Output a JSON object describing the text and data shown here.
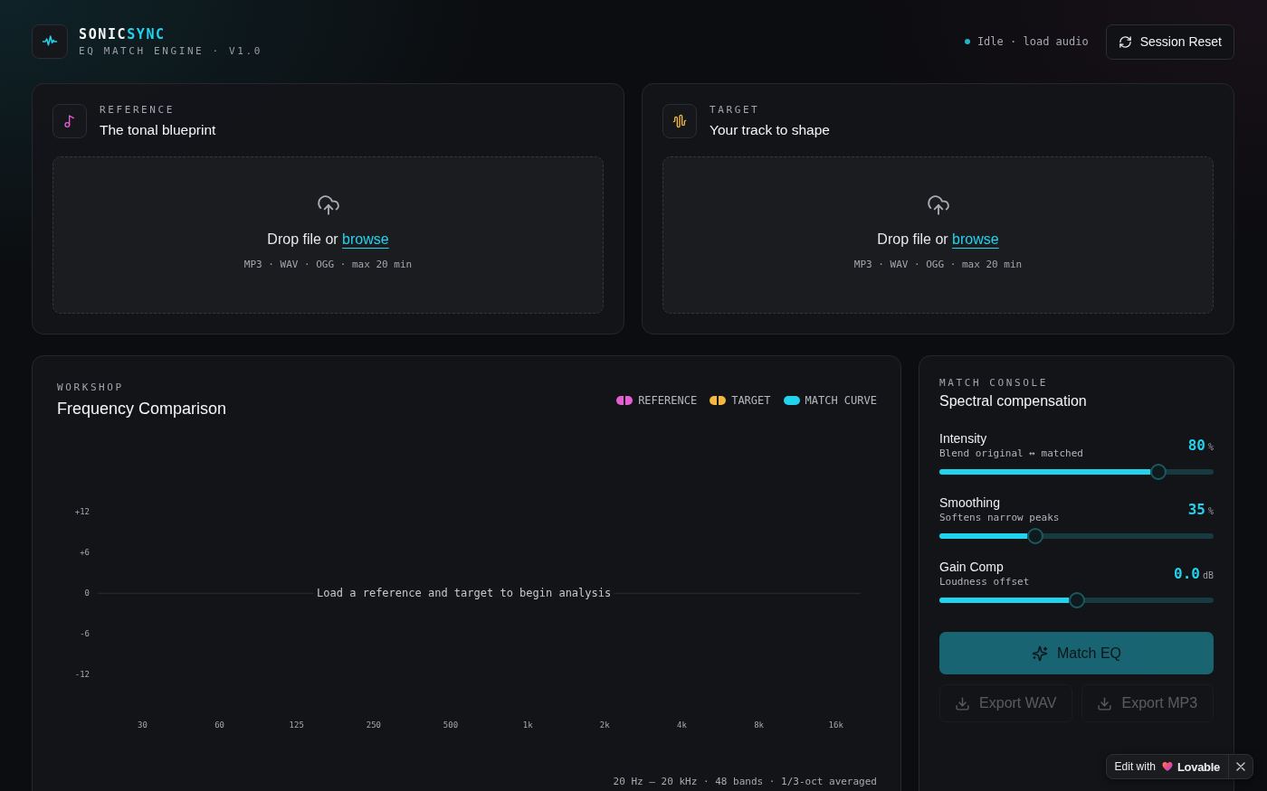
{
  "header": {
    "brand": {
      "name_main": "SONIC",
      "name_accent": "SYNC",
      "subtitle": "EQ MATCH ENGINE · V1.0"
    },
    "status": {
      "text": "Idle · load audio"
    },
    "reset_button": {
      "label": "Session Reset"
    }
  },
  "sources": [
    {
      "kind": "reference",
      "label": "REFERENCE",
      "title": "The tonal blueprint",
      "drop_text": "Drop file or",
      "browse_link": "browse",
      "formats": "MP3 · WAV · OGG · max 20 min"
    },
    {
      "kind": "target",
      "label": "TARGET",
      "title": "Your track to shape",
      "drop_text": "Drop file or",
      "browse_link": "browse",
      "formats": "MP3 · WAV · OGG · max 20 min"
    }
  ],
  "workshop": {
    "eyebrow": "WORKSHOP",
    "title": "Frequency Comparison",
    "legend": [
      {
        "name": "REFERENCE",
        "color": "#e65fd2",
        "kind": "dashed"
      },
      {
        "name": "TARGET",
        "color": "#f4b740",
        "kind": "dashed"
      },
      {
        "name": "MATCH CURVE",
        "color": "#22d3ee",
        "kind": "solid"
      }
    ],
    "chart_data": {
      "type": "line",
      "categories": [
        "30",
        "60",
        "125",
        "250",
        "500",
        "1k",
        "2k",
        "4k",
        "8k",
        "16k"
      ],
      "ylim": [
        -12,
        12
      ],
      "yticks": [
        {
          "value": 12,
          "label": "+12"
        },
        {
          "value": 6,
          "label": "+6"
        },
        0,
        -6,
        -12
      ]
    },
    "empty_message": "Load a reference and target to begin analysis",
    "footer": "20 Hz — 20 kHz · 48 bands · 1/3-oct averaged"
  },
  "console": {
    "eyebrow": "MATCH CONSOLE",
    "title": "Spectral compensation",
    "controls": [
      {
        "label": "Intensity",
        "description": "Blend original ↔ matched",
        "value": "80",
        "unit": "%",
        "level": 0.8
      },
      {
        "label": "Smoothing",
        "description": "Softens narrow peaks",
        "value": "35",
        "unit": "%",
        "level": 0.35
      },
      {
        "label": "Gain Comp",
        "description": "Loudness offset",
        "value": "0.0",
        "unit": "dB",
        "level": 0.5
      }
    ],
    "match_button": {
      "label": "Match EQ",
      "disabled": true
    },
    "export_buttons": [
      {
        "label": "Export WAV",
        "disabled": true
      },
      {
        "label": "Export MP3",
        "disabled": true
      }
    ]
  },
  "badge": {
    "label": "Edit with",
    "brand": "Lovable"
  }
}
